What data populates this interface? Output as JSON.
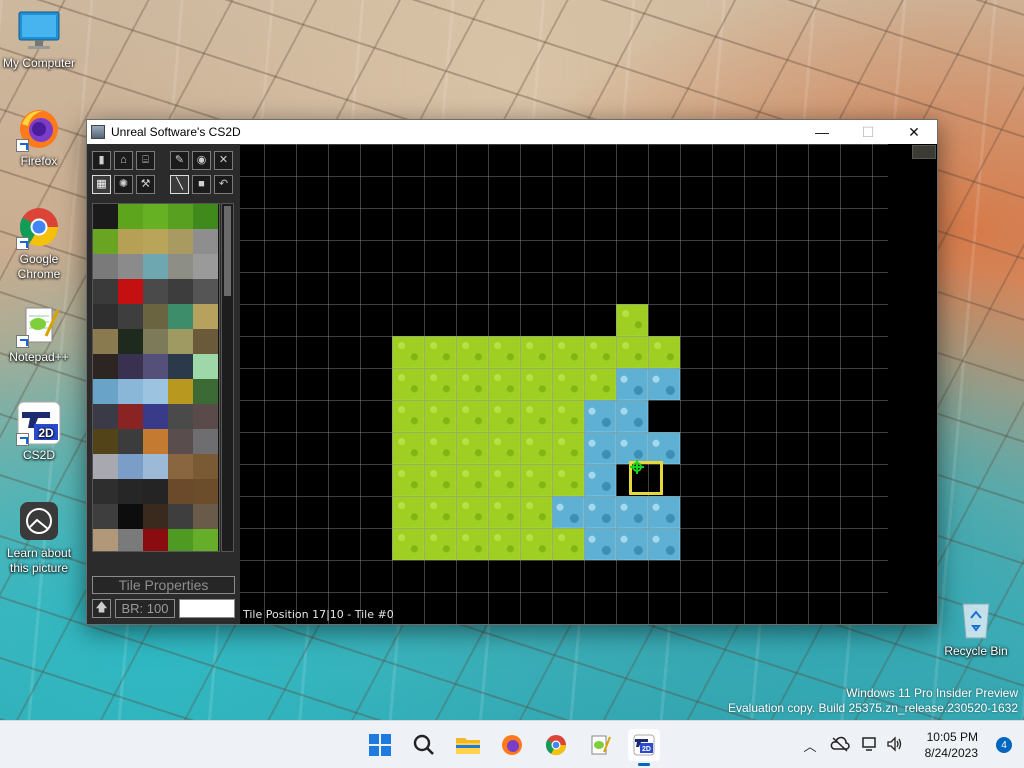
{
  "desktop": {
    "icons": [
      {
        "label": "My Computer"
      },
      {
        "label": "Firefox"
      },
      {
        "label": "Google Chrome"
      },
      {
        "label": "Notepad++"
      },
      {
        "label": "CS2D"
      },
      {
        "label": "Learn about this picture"
      },
      {
        "label": "Recycle Bin"
      }
    ],
    "watermark": {
      "line1": "Windows 11 Pro Insider Preview",
      "line2": "Evaluation copy. Build 25375.zn_release.230520-1632"
    }
  },
  "window": {
    "title": "Unreal Software's CS2D",
    "controls": {
      "minimize": "—",
      "maximize": "☐",
      "close": "✕"
    }
  },
  "editor": {
    "toolbar_row1": [
      "▮",
      "⌂",
      "⌸",
      "✎",
      "◉",
      "✕"
    ],
    "toolbar_row2": [
      "▦",
      "✺",
      "⚒",
      "╲",
      "■",
      "↶"
    ],
    "tile_properties_label": "Tile Properties",
    "up_arrow": "🡅",
    "brush_label": "BR: 100",
    "status_text": "Tile Position 17|10  -  Tile #0"
  },
  "colors": {
    "grass": "#9fcf22",
    "water": "#5fb1d3",
    "cursor": "#e8d83a",
    "crosshair": "#1dd21d"
  },
  "taskbar": {
    "icons": [
      "start-icon",
      "search-icon",
      "file-explorer-icon",
      "firefox-icon",
      "chrome-icon",
      "notepadpp-icon",
      "cs2d-icon"
    ],
    "clock": {
      "time": "10:05 PM",
      "date": "8/24/2023"
    },
    "notification_count": "4"
  }
}
